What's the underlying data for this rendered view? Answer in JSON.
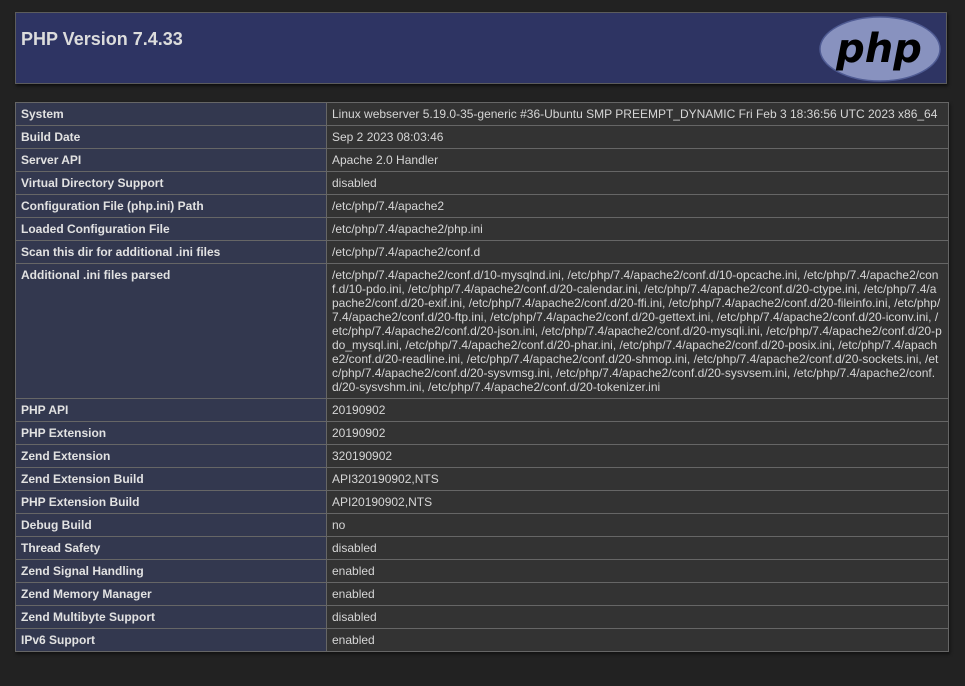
{
  "header": {
    "title": "PHP Version 7.4.33",
    "logo_text": "php"
  },
  "rows": [
    {
      "key": "System",
      "value": "Linux webserver 5.19.0-35-generic #36-Ubuntu SMP PREEMPT_DYNAMIC Fri Feb 3 18:36:56 UTC 2023 x86_64"
    },
    {
      "key": "Build Date",
      "value": "Sep 2 2023 08:03:46"
    },
    {
      "key": "Server API",
      "value": "Apache 2.0 Handler"
    },
    {
      "key": "Virtual Directory Support",
      "value": "disabled"
    },
    {
      "key": "Configuration File (php.ini) Path",
      "value": "/etc/php/7.4/apache2"
    },
    {
      "key": "Loaded Configuration File",
      "value": "/etc/php/7.4/apache2/php.ini"
    },
    {
      "key": "Scan this dir for additional .ini files",
      "value": "/etc/php/7.4/apache2/conf.d"
    },
    {
      "key": "Additional .ini files parsed",
      "value": "/etc/php/7.4/apache2/conf.d/10-mysqlnd.ini, /etc/php/7.4/apache2/conf.d/10-opcache.ini, /etc/php/7.4/apache2/conf.d/10-pdo.ini, /etc/php/7.4/apache2/conf.d/20-calendar.ini, /etc/php/7.4/apache2/conf.d/20-ctype.ini, /etc/php/7.4/apache2/conf.d/20-exif.ini, /etc/php/7.4/apache2/conf.d/20-ffi.ini, /etc/php/7.4/apache2/conf.d/20-fileinfo.ini, /etc/php/7.4/apache2/conf.d/20-ftp.ini, /etc/php/7.4/apache2/conf.d/20-gettext.ini, /etc/php/7.4/apache2/conf.d/20-iconv.ini, /etc/php/7.4/apache2/conf.d/20-json.ini, /etc/php/7.4/apache2/conf.d/20-mysqli.ini, /etc/php/7.4/apache2/conf.d/20-pdo_mysql.ini, /etc/php/7.4/apache2/conf.d/20-phar.ini, /etc/php/7.4/apache2/conf.d/20-posix.ini, /etc/php/7.4/apache2/conf.d/20-readline.ini, /etc/php/7.4/apache2/conf.d/20-shmop.ini, /etc/php/7.4/apache2/conf.d/20-sockets.ini, /etc/php/7.4/apache2/conf.d/20-sysvmsg.ini, /etc/php/7.4/apache2/conf.d/20-sysvsem.ini, /etc/php/7.4/apache2/conf.d/20-sysvshm.ini, /etc/php/7.4/apache2/conf.d/20-tokenizer.ini"
    },
    {
      "key": "PHP API",
      "value": "20190902"
    },
    {
      "key": "PHP Extension",
      "value": "20190902"
    },
    {
      "key": "Zend Extension",
      "value": "320190902"
    },
    {
      "key": "Zend Extension Build",
      "value": "API320190902,NTS"
    },
    {
      "key": "PHP Extension Build",
      "value": "API20190902,NTS"
    },
    {
      "key": "Debug Build",
      "value": "no"
    },
    {
      "key": "Thread Safety",
      "value": "disabled"
    },
    {
      "key": "Zend Signal Handling",
      "value": "enabled"
    },
    {
      "key": "Zend Memory Manager",
      "value": "enabled"
    },
    {
      "key": "Zend Multibyte Support",
      "value": "disabled"
    },
    {
      "key": "IPv6 Support",
      "value": "enabled"
    }
  ],
  "colors": {
    "page_bg": "#222222",
    "header_bg": "#2e3463",
    "key_cell_bg": "#33384f",
    "value_cell_bg": "#333333",
    "logo_fill": "#8892bf"
  }
}
